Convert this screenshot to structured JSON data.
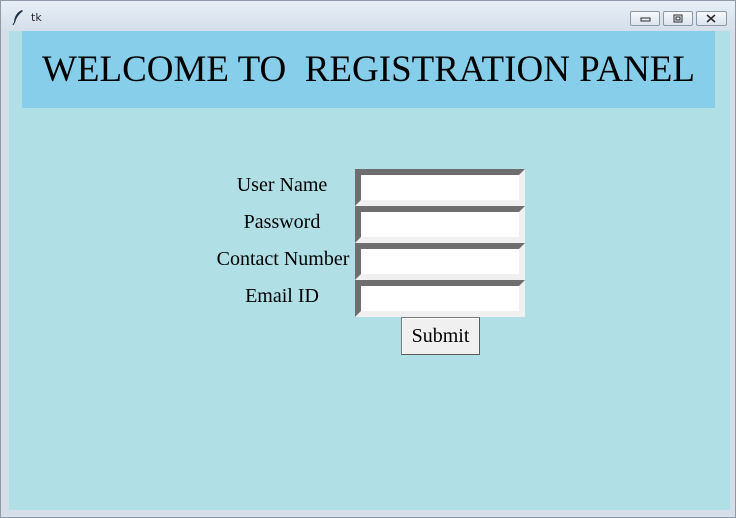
{
  "window": {
    "title": "tk"
  },
  "banner": {
    "text": "WELCOME TO  REGISTRATION PANEL"
  },
  "form": {
    "fields": [
      {
        "label": "User Name",
        "value": ""
      },
      {
        "label": "Password",
        "value": ""
      },
      {
        "label": "Contact Number",
        "value": ""
      },
      {
        "label": "Email ID",
        "value": ""
      }
    ],
    "submit_label": "Submit"
  },
  "colors": {
    "background": "#b0dfe5",
    "banner": "#87ceeb"
  }
}
